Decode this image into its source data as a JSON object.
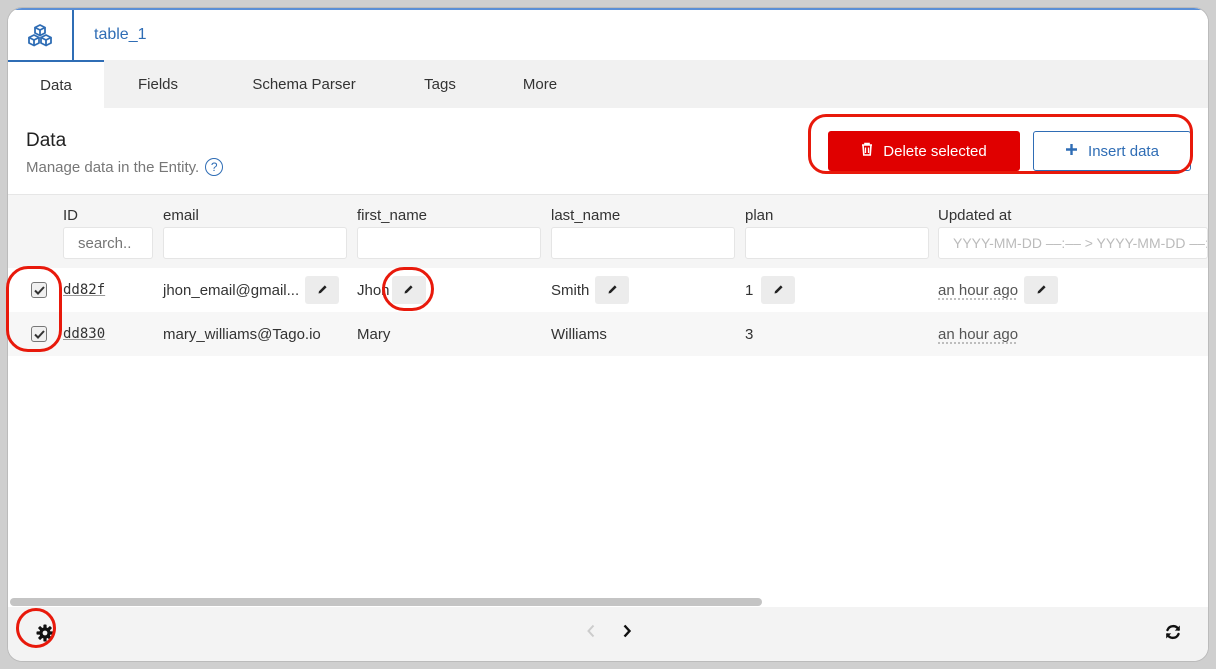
{
  "header": {
    "title": "table_1",
    "logo_icon": "cubes-icon"
  },
  "tabs": [
    {
      "label": "Data",
      "active": true
    },
    {
      "label": "Fields"
    },
    {
      "label": "Schema Parser"
    },
    {
      "label": "Tags"
    },
    {
      "label": "More"
    }
  ],
  "section": {
    "title": "Data",
    "subtitle": "Manage data in the Entity.",
    "help_glyph": "?"
  },
  "actions": {
    "delete_label": "Delete selected",
    "insert_label": "Insert data",
    "delete_color": "#e00000",
    "accent_color": "#2f6db5"
  },
  "table": {
    "columns": [
      "ID",
      "email",
      "first_name",
      "last_name",
      "plan",
      "Updated at"
    ],
    "filters": {
      "id_placeholder": "search..",
      "date_placeholder": "YYYY-MM-DD ––:–– > YYYY-MM-DD ––:––"
    },
    "rows": [
      {
        "id": "dd82f",
        "email": "jhon_email@gmail...",
        "first_name": "Jhon",
        "last_name": "Smith",
        "plan": "1",
        "updated": "an hour ago",
        "checked": true
      },
      {
        "id": "dd830",
        "email": "mary_williams@Tago.io",
        "first_name": "Mary",
        "last_name": "Williams",
        "plan": "3",
        "updated": "an hour ago",
        "checked": true
      }
    ]
  },
  "highlight_color": "#e8190b"
}
